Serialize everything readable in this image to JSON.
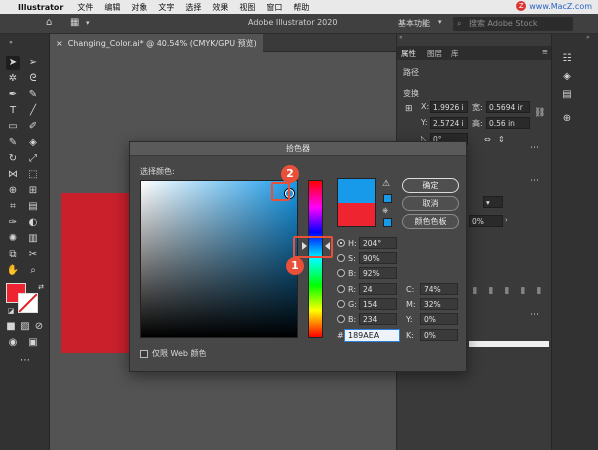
{
  "menubar": {
    "app": "Illustrator",
    "items": [
      "文件",
      "编辑",
      "对象",
      "文字",
      "选择",
      "效果",
      "视图",
      "窗口",
      "帮助"
    ],
    "brand": "www.MacZ.com"
  },
  "appbar": {
    "title": "Adobe Illustrator 2020",
    "workspace": "基本功能",
    "search_placeholder": "搜索 Adobe Stock"
  },
  "doc_tab": {
    "label": "Changing_Color.ai* @ 40.54% (CMYK/GPU 预览)"
  },
  "panel": {
    "tabs": [
      "属性",
      "图层",
      "库"
    ],
    "section_path": "路径",
    "section_transform": "变换",
    "x_label": "X:",
    "x_value": "1.9926 i",
    "y_label": "Y:",
    "y_value": "2.5724 i",
    "w_label": "宽:",
    "w_value": "0.5694 ir",
    "h_label": "高:",
    "h_value": "0.56 in",
    "angle_value": "0°",
    "opacity_value": "0%"
  },
  "dialog": {
    "title": "拾色器",
    "pick_label": "选择颜色:",
    "ok_label": "确定",
    "cancel_label": "取消",
    "swatches_label": "颜色色板",
    "web_only_label": "仅限 Web 颜色",
    "hsb": {
      "h_label": "H:",
      "h": "204°",
      "s_label": "S:",
      "s": "90%",
      "b_label": "B:",
      "b": "92%"
    },
    "rgb": {
      "r_label": "R:",
      "r": "24",
      "g_label": "G:",
      "g": "154",
      "b_label": "B:",
      "b": "234"
    },
    "cmyk": {
      "c_label": "C:",
      "c": "74%",
      "m_label": "M:",
      "m": "32%",
      "y_label": "Y:",
      "y": "0%",
      "k_label": "K:",
      "k": "0%"
    },
    "hex_label": "#",
    "hex": "189AEA",
    "new_color": "#189aea",
    "old_color": "#ee2530"
  },
  "callouts": {
    "one": "1",
    "two": "2"
  },
  "colors": {
    "accent": "#e8503a",
    "fill": "#ee2530",
    "artwork": "#c9202c"
  }
}
